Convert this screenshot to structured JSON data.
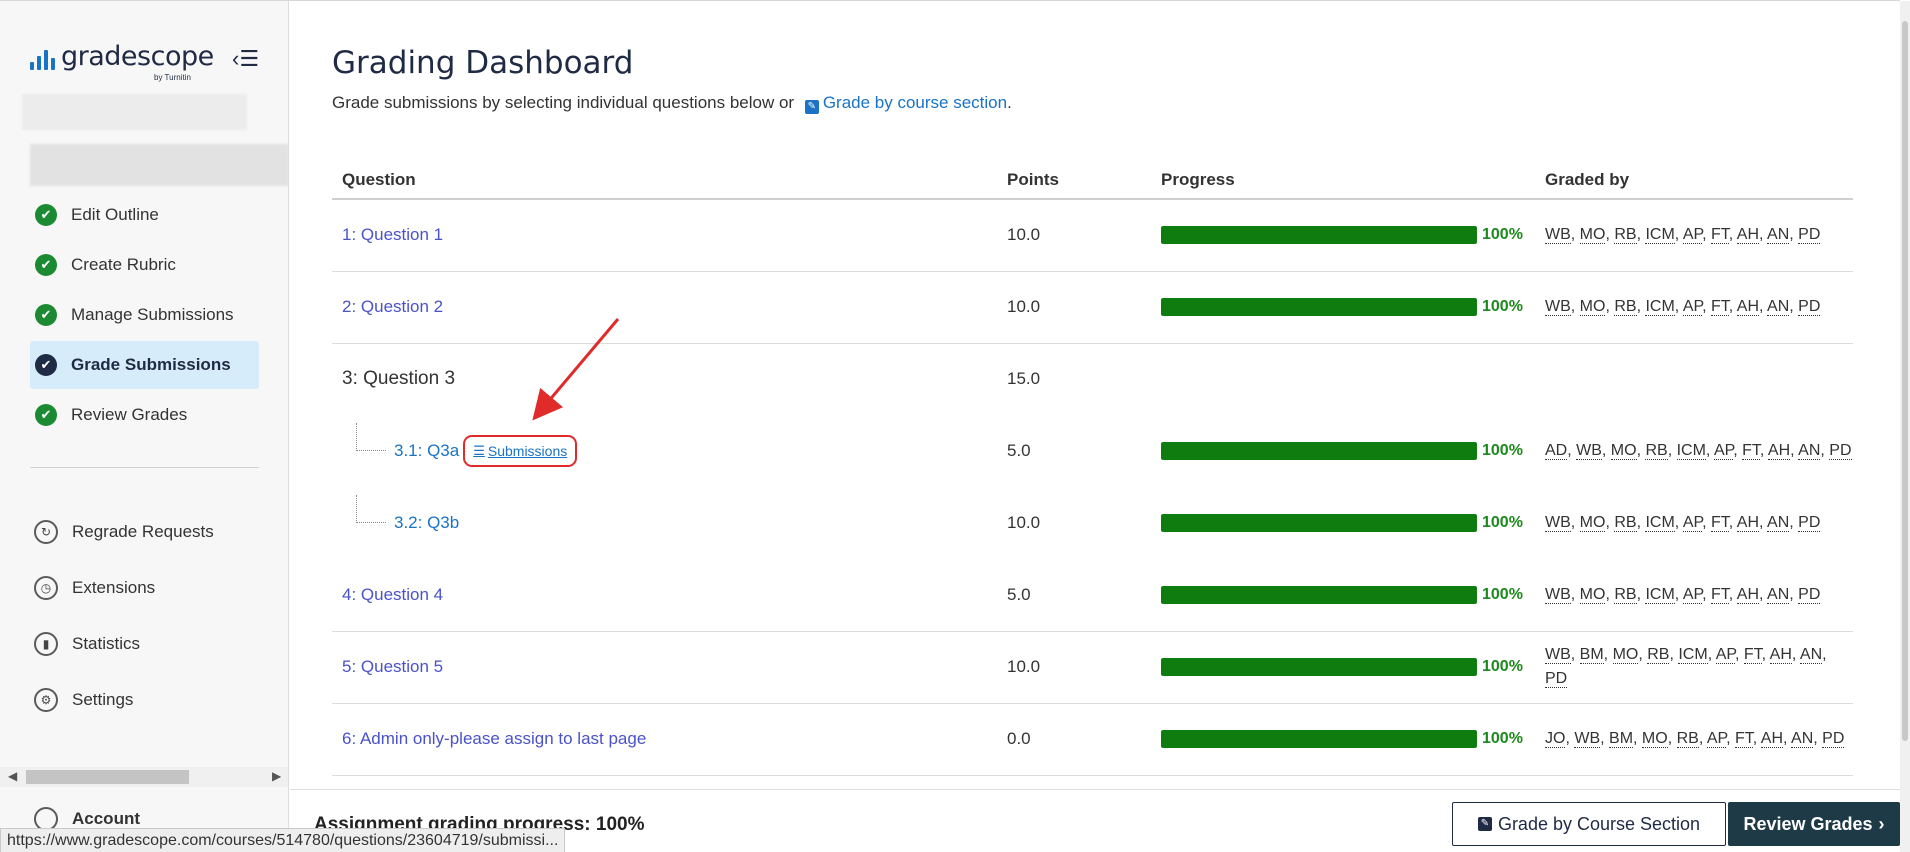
{
  "logo": {
    "name": "gradescope",
    "sub": "by Turnitin",
    "brand_color": "#1a73c4"
  },
  "sidebar": {
    "collapse_icon": "collapse-menu-icon",
    "steps": [
      {
        "label": "Edit Outline",
        "icon": "check-circle-icon",
        "active": false
      },
      {
        "label": "Create Rubric",
        "icon": "check-circle-icon",
        "active": false
      },
      {
        "label": "Manage Submissions",
        "icon": "check-circle-icon",
        "active": false
      },
      {
        "label": "Grade Submissions",
        "icon": "check-circle-icon",
        "active": true
      },
      {
        "label": "Review Grades",
        "icon": "check-circle-icon",
        "active": false
      }
    ],
    "tools": [
      {
        "label": "Regrade Requests",
        "icon": "regrade-icon"
      },
      {
        "label": "Extensions",
        "icon": "clock-icon"
      },
      {
        "label": "Statistics",
        "icon": "chart-icon"
      },
      {
        "label": "Settings",
        "icon": "gear-icon"
      }
    ],
    "account": "Account"
  },
  "main": {
    "title": "Grading Dashboard",
    "intro_text": "Grade submissions by selecting individual questions below or ",
    "intro_link": "Grade by course section",
    "intro_end": ".",
    "columns": {
      "question": "Question",
      "points": "Points",
      "progress": "Progress",
      "graded_by": "Graded by"
    },
    "rows": [
      {
        "type": "question",
        "label": "1: Question 1",
        "points": "10.0",
        "progress": 1.0,
        "pct": "100%",
        "graders": "WB, MO, RB, ICM, AP, FT, AH, AN, PD"
      },
      {
        "type": "question",
        "label": "2: Question 2",
        "points": "10.0",
        "progress": 1.0,
        "pct": "100%",
        "graders": "WB, MO, RB, ICM, AP, FT, AH, AN, PD"
      },
      {
        "type": "parent",
        "label": "3: Question 3",
        "points": "15.0"
      },
      {
        "type": "sub",
        "label": "3.1: Q3a",
        "submissions": "Submissions",
        "points": "5.0",
        "progress": 1.0,
        "pct": "100%",
        "graders": "AD, WB, MO, RB, ICM, AP, FT, AH, AN, PD"
      },
      {
        "type": "sub",
        "label": "3.2: Q3b",
        "points": "10.0",
        "progress": 1.0,
        "pct": "100%",
        "graders": "WB, MO, RB, ICM, AP, FT, AH, AN, PD"
      },
      {
        "type": "question",
        "label": "4: Question 4",
        "points": "5.0",
        "progress": 1.0,
        "pct": "100%",
        "graders": "WB, MO, RB, ICM, AP, FT, AH, AN, PD"
      },
      {
        "type": "question",
        "label": "5: Question 5",
        "points": "10.0",
        "progress": 1.0,
        "pct": "100%",
        "graders": "WB, BM, MO, RB, ICM, AP, FT, AH, AN, PD"
      },
      {
        "type": "question",
        "label": "6: Admin only-please assign to last page",
        "points": "0.0",
        "progress": 1.0,
        "pct": "100%",
        "graders": "JO, WB, BM, MO, RB, AP, FT, AH, AN, PD"
      }
    ]
  },
  "footer": {
    "progress_text": "Assignment grading progress: 100%",
    "grade_section_button": "Grade by Course Section",
    "review_button": "Review Grades",
    "review_icon": "chevron-right-icon"
  },
  "status_bar": {
    "url": "https://www.gradescope.com/courses/514780/questions/23604719/submissi..."
  },
  "colors": {
    "progress": "#0e7c0e",
    "active_nav": "#d7ecfb",
    "annotation": "#e02b2b"
  }
}
